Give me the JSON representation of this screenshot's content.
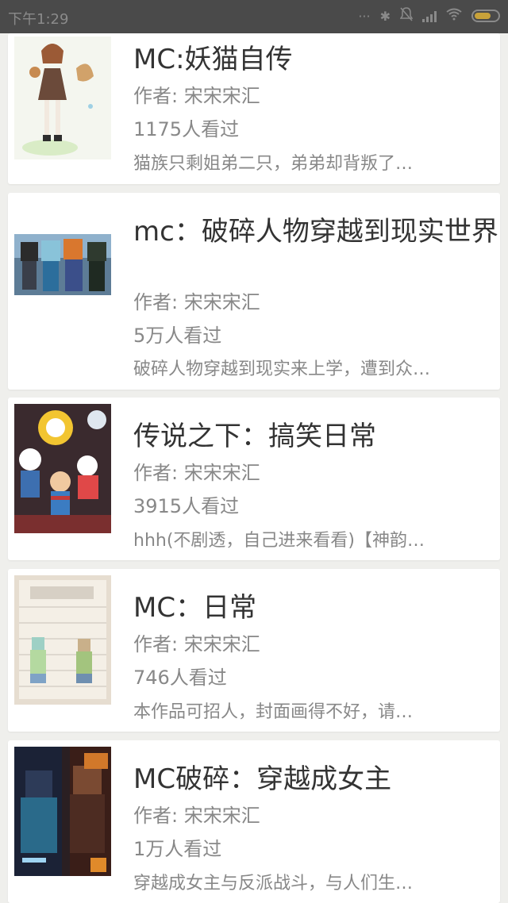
{
  "status_bar": {
    "time": "下午1:29",
    "battery_color": "#c8a23a"
  },
  "books": [
    {
      "title": "MC:妖猫自传",
      "author": "作者: 宋宋宋汇",
      "views": "1175人看过",
      "description": "猫族只剩姐弟二只，弟弟却背叛了…"
    },
    {
      "title": "mc：破碎人物穿越到现实世界",
      "author": "作者: 宋宋宋汇",
      "views": "5万人看过",
      "description": "破碎人物穿越到现实来上学，遭到众…"
    },
    {
      "title": "传说之下：搞笑日常",
      "author": "作者: 宋宋宋汇",
      "views": "3915人看过",
      "description": "hhh(不剧透，自己进来看看)【神韵…"
    },
    {
      "title": "MC：日常",
      "author": "作者: 宋宋宋汇",
      "views": "746人看过",
      "description": "本作品可招人，封面画得不好，请…"
    },
    {
      "title": "MC破碎：穿越成女主",
      "author": "作者: 宋宋宋汇",
      "views": "1万人看过",
      "description": "穿越成女主与反派战斗，与人们生…"
    }
  ]
}
